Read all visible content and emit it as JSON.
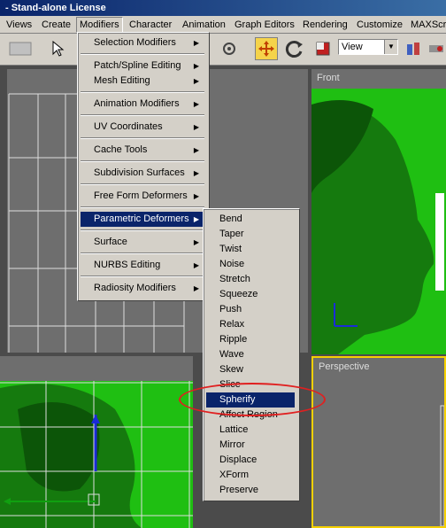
{
  "window": {
    "title": "- Stand-alone License"
  },
  "menubar": [
    {
      "label": "Views"
    },
    {
      "label": "Create"
    },
    {
      "label": "Modifiers"
    },
    {
      "label": "Character"
    },
    {
      "label": "Animation"
    },
    {
      "label": "Graph Editors"
    },
    {
      "label": "Rendering"
    },
    {
      "label": "Customize"
    },
    {
      "label": "MAXScrip"
    }
  ],
  "toolbar": {
    "view_select": "View"
  },
  "viewports": {
    "front": "Front",
    "perspective": "Perspective"
  },
  "modifiers_menu": [
    {
      "label": "Selection Modifiers"
    },
    {
      "label": "Patch/Spline Editing"
    },
    {
      "label": "Mesh Editing"
    },
    {
      "label": "Animation Modifiers"
    },
    {
      "label": "UV Coordinates"
    },
    {
      "label": "Cache Tools"
    },
    {
      "label": "Subdivision Surfaces"
    },
    {
      "label": "Free Form Deformers"
    },
    {
      "label": "Parametric Deformers"
    },
    {
      "label": "Surface"
    },
    {
      "label": "NURBS Editing"
    },
    {
      "label": "Radiosity Modifiers"
    }
  ],
  "parametric_submenu": [
    "Bend",
    "Taper",
    "Twist",
    "Noise",
    "Stretch",
    "Squeeze",
    "Push",
    "Relax",
    "Ripple",
    "Wave",
    "Skew",
    "Slice",
    "Spherify",
    "Affect Region",
    "Lattice",
    "Mirror",
    "Displace",
    "XForm",
    "Preserve"
  ],
  "colors": {
    "highlight": "#0a246a",
    "viewport_green": "#1fbf12",
    "annotation": "#e02020"
  }
}
